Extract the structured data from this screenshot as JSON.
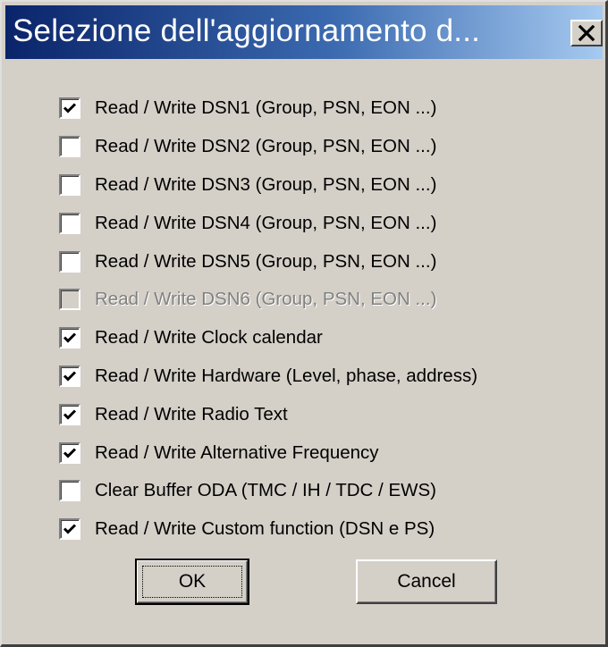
{
  "dialog": {
    "title": "Selezione dell'aggiornamento d...",
    "close_icon": "close-icon"
  },
  "options": [
    {
      "label": "Read / Write DSN1  (Group, PSN, EON ...)",
      "checked": true,
      "enabled": true
    },
    {
      "label": "Read / Write DSN2  (Group, PSN, EON ...)",
      "checked": false,
      "enabled": true
    },
    {
      "label": "Read / Write DSN3  (Group, PSN, EON ...)",
      "checked": false,
      "enabled": true
    },
    {
      "label": "Read / Write DSN4  (Group, PSN, EON ...)",
      "checked": false,
      "enabled": true
    },
    {
      "label": "Read / Write DSN5  (Group, PSN, EON ...)",
      "checked": false,
      "enabled": true
    },
    {
      "label": "Read / Write DSN6  (Group, PSN, EON ...)",
      "checked": false,
      "enabled": false
    },
    {
      "label": "Read / Write Clock calendar",
      "checked": true,
      "enabled": true
    },
    {
      "label": "Read / Write Hardware (Level, phase, address)",
      "checked": true,
      "enabled": true
    },
    {
      "label": "Read / Write Radio Text",
      "checked": true,
      "enabled": true
    },
    {
      "label": "Read / Write Alternative Frequency",
      "checked": true,
      "enabled": true
    },
    {
      "label": "Clear Buffer ODA (TMC / IH / TDC / EWS)",
      "checked": false,
      "enabled": true
    },
    {
      "label": "Read / Write Custom function  (DSN e PS)",
      "checked": true,
      "enabled": true
    }
  ],
  "buttons": {
    "ok_label": "OK",
    "cancel_label": "Cancel"
  },
  "colors": {
    "title_gradient_start": "#0a246a",
    "title_gradient_end": "#a6caf0",
    "face": "#d4d0c8",
    "disabled_text": "#808080"
  }
}
